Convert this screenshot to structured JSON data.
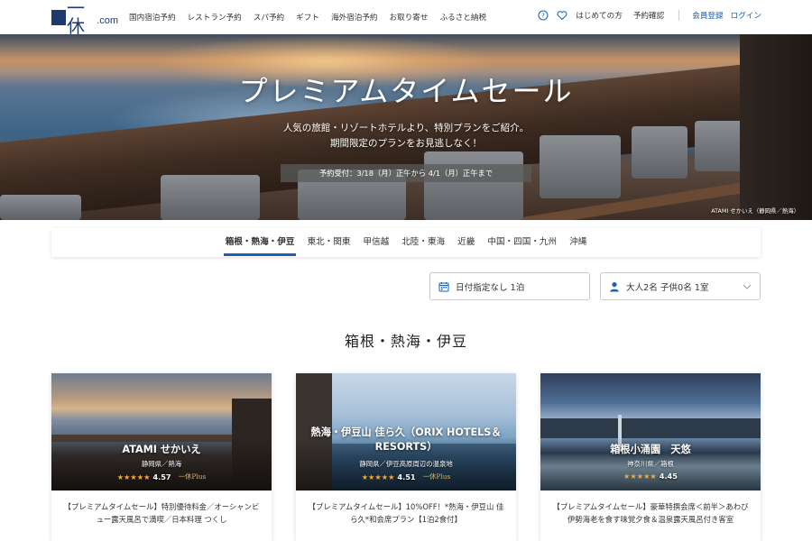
{
  "header": {
    "logo_text": "一休",
    "logo_suffix": ".com",
    "nav": [
      "国内宿泊予約",
      "レストラン予約",
      "スパ予約",
      "ギフト",
      "海外宿泊予約",
      "お取り寄せ",
      "ふるさと納税"
    ],
    "first_time": "はじめての方",
    "reservation_check": "予約確認",
    "register": "会員登録",
    "login": "ログイン"
  },
  "hero": {
    "title": "プレミアムタイムセール",
    "subtitle_line1": "人気の旅館・リゾートホテルより、特別プランをご紹介。",
    "subtitle_line2": "期間限定のプランをお見逃しなく！",
    "period": "予約受付：3/18（月）正午から 4/1（月）正午まで",
    "credit": "ATAMI せかいえ（静岡県／熱海）"
  },
  "regions": {
    "tabs": [
      "箱根・熱海・伊豆",
      "東北・関東",
      "甲信越",
      "北陸・東海",
      "近畿",
      "中国・四国・九州",
      "沖縄"
    ],
    "active": "箱根・熱海・伊豆"
  },
  "search": {
    "date": "日付指定なし 1泊",
    "guests": "大人2名  子供0名  1室"
  },
  "section": {
    "title": "箱根・熱海・伊豆"
  },
  "cards": [
    {
      "name": "ATAMI せかいえ",
      "location": "静岡県／熱海",
      "stars": "★★★★★",
      "score": "4.57",
      "badge": "一休Plus",
      "description": "【プレミアムタイムセール】特別優待料金／オーシャンビュー露天風呂で満喫／日本料理 つくし"
    },
    {
      "name": "熱海・伊豆山 佳ら久（ORIX HOTELS＆RESORTS）",
      "location": "静岡県／伊豆高原周辺の温泉地",
      "stars": "★★★★★",
      "score": "4.51",
      "badge": "一休Plus",
      "description": "【プレミアムタイムセール】10%OFF！*熱海・伊豆山 佳ら久*和会席プラン【1泊2食付】"
    },
    {
      "name": "箱根小涌園　天悠",
      "location": "神奈川県／箱根",
      "stars": "★★★★★",
      "score": "4.45",
      "badge": "",
      "description": "【プレミアムタイムセール】豪華特撰会席＜前半＞あわび伊勢海老を食す味覚夕食＆温泉露天風呂付き客室"
    }
  ],
  "colors": {
    "brand": "#1d3a6e",
    "link": "#1a5fb4",
    "star": "#f2a93b"
  }
}
